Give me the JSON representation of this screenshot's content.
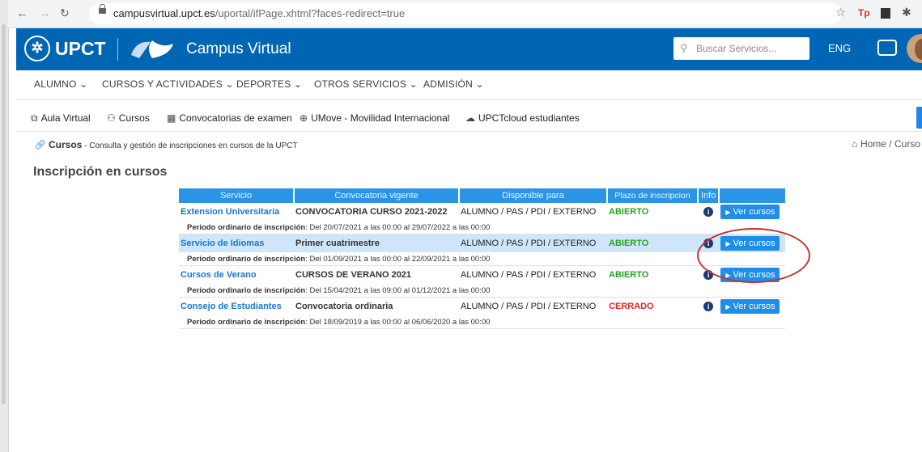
{
  "browser": {
    "url_host": "campusvirtual.upct.es",
    "url_path": "/uportal/ifPage.xhtml?faces-redirect=true"
  },
  "header": {
    "brand": "UPCT",
    "title": "Campus Virtual",
    "search_placeholder": "Buscar Servicios...",
    "lang": "ENG",
    "brand_color": "#0066b3"
  },
  "menu": [
    "ALUMNO ⌄",
    "CURSOS Y ACTIVIDADES ⌄",
    "DEPORTES ⌄",
    "OTROS SERVICIOS ⌄",
    "ADMISIÓN ⌄"
  ],
  "quick_links": [
    {
      "icon": "external-link-icon",
      "label": "Aula Virtual"
    },
    {
      "icon": "users-icon",
      "label": "Cursos"
    },
    {
      "icon": "calendar-icon",
      "label": "Convocatorias de examen"
    },
    {
      "icon": "globe-icon",
      "label": "UMove - Movilidad Internacional"
    },
    {
      "icon": "cloud-icon",
      "label": "UPCTcloud estudiantes"
    }
  ],
  "breadcrumb": {
    "title": "Cursos",
    "subtitle": " - Consulta y gestión de inscripciones en cursos de la UPCT",
    "home": "Home",
    "sep": " / ",
    "current": "Curso"
  },
  "page_title": "Inscripción en cursos",
  "table": {
    "headers": [
      "Servicio",
      "Convocatoria vigente",
      "Disponible para",
      "Plazo de inscripcion",
      "Info"
    ],
    "period_label": "Periodo ordinario de inscripción",
    "button_label": "Ver cursos",
    "rows": [
      {
        "servicio": "Extension Universitaria",
        "convocatoria": "CONVOCATORIA CURSO 2021-2022",
        "disponible": "ALUMNO / PAS / PDI / EXTERNO",
        "plazo": "ABIERTO",
        "periodo": ": Del 20/07/2021 a las 00:00 al 29/07/2022 a las 00:00"
      },
      {
        "servicio": "Servicio de Idiomas",
        "convocatoria": "Primer cuatrimestre",
        "disponible": "ALUMNO / PAS / PDI / EXTERNO",
        "plazo": "ABIERTO",
        "periodo": ": Del 01/09/2021 a las 00:00 al 22/09/2021 a las 00:00"
      },
      {
        "servicio": "Cursos de Verano",
        "convocatoria": "CURSOS DE VERANO 2021",
        "disponible": "ALUMNO / PAS / PDI / EXTERNO",
        "plazo": "ABIERTO",
        "periodo": ": Del 15/04/2021 a las 09:00 al 01/12/2021 a las 00:00"
      },
      {
        "servicio": "Consejo de Estudiantes",
        "convocatoria": "Convocatoria ordinaria",
        "disponible": "ALUMNO / PAS / PDI / EXTERNO",
        "plazo": "CERRADO",
        "periodo": ": Del 18/09/2019 a las 00:00 al 06/06/2020 a las 00:00"
      }
    ]
  }
}
